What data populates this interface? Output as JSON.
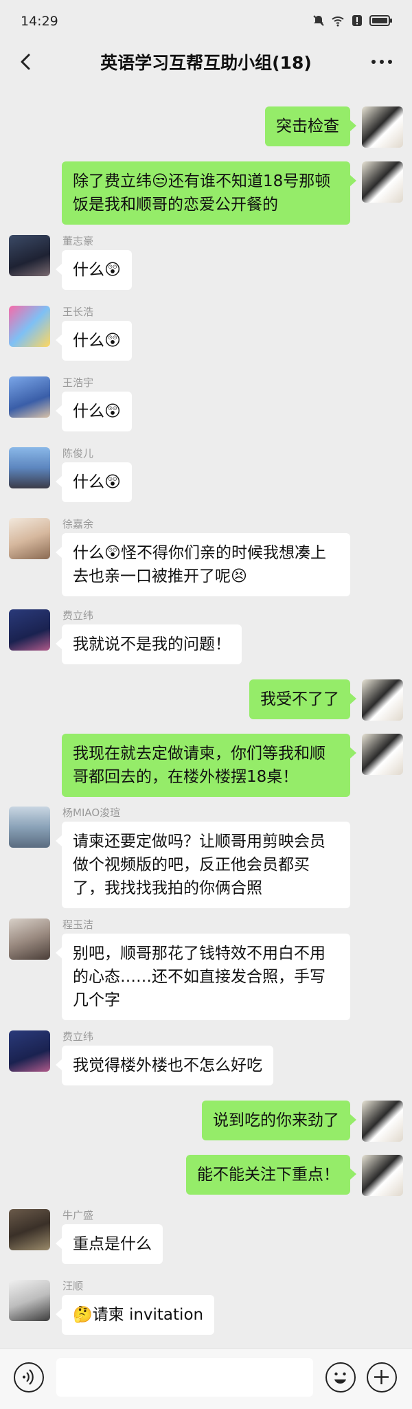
{
  "status_bar": {
    "time": "14:29",
    "icons": [
      "mute-icon",
      "wifi-icon",
      "alert-icon",
      "battery-icon"
    ]
  },
  "header": {
    "title": "英语学习互帮互助小组(18)",
    "back_icon": "chevron-left-icon",
    "more_icon": "more-dots-icon"
  },
  "messages": [
    {
      "side": "out",
      "text": "突击检查"
    },
    {
      "side": "out",
      "text": "除了费立纬😒还有谁不知道18号那顿饭是我和顺哥的恋爱公开餐的"
    },
    {
      "side": "in",
      "sender": "董志豪",
      "text": "什么😲"
    },
    {
      "side": "in",
      "sender": "王长浩",
      "text": "什么😲"
    },
    {
      "side": "in",
      "sender": "王浩宇",
      "text": "什么😲"
    },
    {
      "side": "in",
      "sender": "陈俊儿",
      "text": "什么😲"
    },
    {
      "side": "in",
      "sender": "徐嘉余",
      "text": "什么😲怪不得你们亲的时候我想凑上去也亲一口被推开了呢😣"
    },
    {
      "side": "in",
      "sender": "费立纬",
      "text": "我就说不是我的问题！"
    },
    {
      "side": "out",
      "text": "我受不了了"
    },
    {
      "side": "out",
      "text": "我现在就去定做请柬，你们等我和顺哥都回去的，在楼外楼摆18桌！"
    },
    {
      "side": "in",
      "sender": "杨MIAO浚瑄",
      "text": "请柬还要定做吗？让顺哥用剪映会员做个视频版的吧，反正他会员都买了，我找找我拍的你俩合照"
    },
    {
      "side": "in",
      "sender": "程玉洁",
      "text": "别吧，顺哥那花了钱特效不用白不用的心态……还不如直接发合照，手写几个字"
    },
    {
      "side": "in",
      "sender": "费立纬",
      "text": "我觉得楼外楼也不怎么好吃"
    },
    {
      "side": "out",
      "text": "说到吃的你来劲了"
    },
    {
      "side": "out",
      "text": "能不能关注下重点！"
    },
    {
      "side": "in",
      "sender": "牛广盛",
      "text": "重点是什么"
    },
    {
      "side": "in",
      "sender": "汪顺",
      "text": "🤔请柬 invitation"
    }
  ],
  "input_bar": {
    "voice_icon": "voice-icon",
    "emoji_icon": "emoji-icon",
    "plus_icon": "plus-icon",
    "placeholder": ""
  },
  "colors": {
    "background": "#ededed",
    "outgoing_bubble": "#95ec69",
    "incoming_bubble": "#ffffff"
  }
}
